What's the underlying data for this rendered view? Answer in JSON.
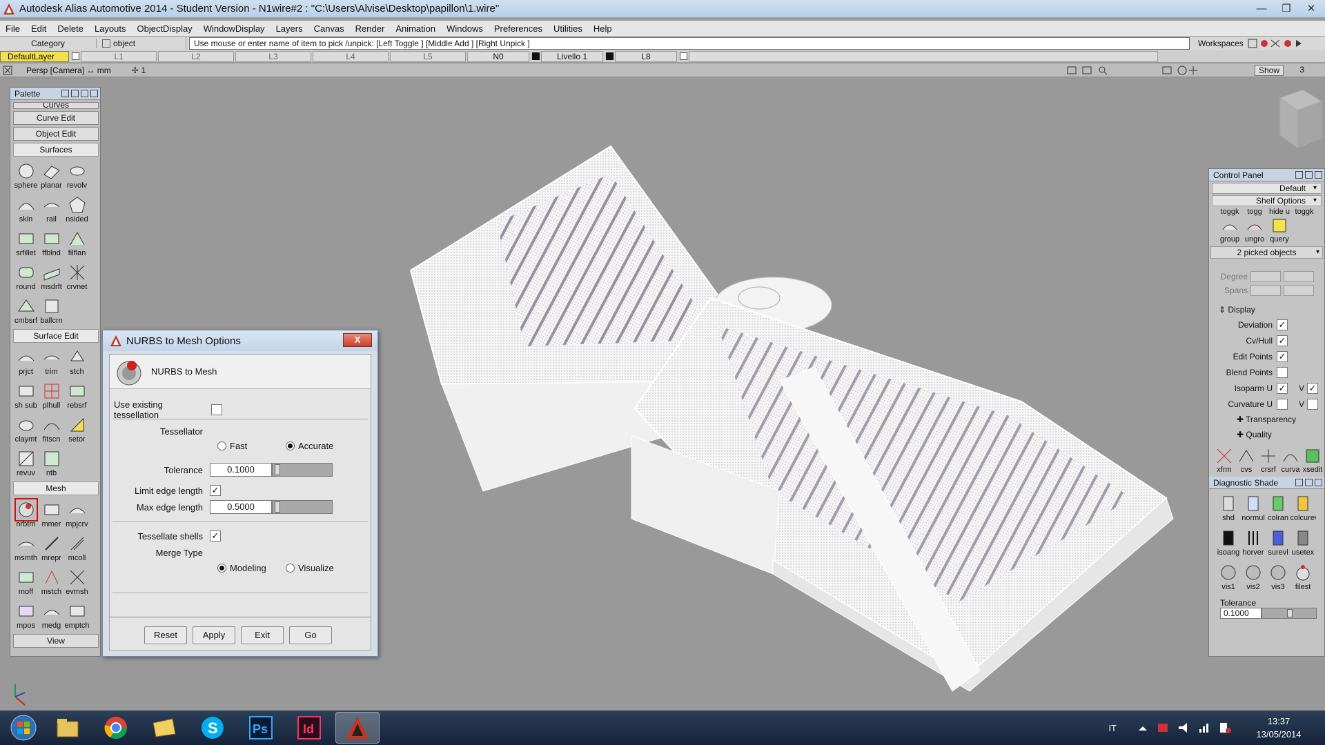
{
  "window": {
    "title": "Autodesk Alias Automotive 2014   - Student Version   - N1wire#2 : \"C:\\Users\\Alvise\\Desktop\\papillon\\1.wire\"",
    "controls": [
      "—",
      "❐",
      "✕"
    ]
  },
  "menu": [
    "File",
    "Edit",
    "Delete",
    "Layouts",
    "ObjectDisplay",
    "WindowDisplay",
    "Layers",
    "Canvas",
    "Render",
    "Animation",
    "Windows",
    "Preferences",
    "Utilities",
    "Help"
  ],
  "prompt": {
    "category": "Category",
    "object": "object",
    "text": "Use mouse or enter name of item to pick /unpick: [Left Toggle ] [Middle Add ] [Right Unpick ]",
    "workspaces": "Workspaces"
  },
  "layers": {
    "default": "DefaultLayer",
    "slots": [
      "L1",
      "L2",
      "L3",
      "L4",
      "L5"
    ],
    "n0": "N0",
    "livello": "Livello 1",
    "l8": "L8"
  },
  "viewbar": {
    "camera": "Persp [Camera] ↔ mm",
    "count": "1",
    "show": "Show",
    "num": "3"
  },
  "palette": {
    "title": "Palette",
    "curves": "Curves",
    "curve_edit": "Curve Edit",
    "object_edit": "Object Edit",
    "surfaces": "Surfaces",
    "surfaces_tools": [
      "sphere",
      "planar",
      "revolv",
      "skin",
      "rail",
      "nsided",
      "srfillet",
      "ffblnd",
      "filflan",
      "round",
      "msdrft",
      "crvnet",
      "cmbsrf",
      "ballcrn"
    ],
    "surface_edit": "Surface Edit",
    "surface_edit_tools": [
      "prjct",
      "trim",
      "stch",
      "sh sub",
      "plhull",
      "rebsrf",
      "claymt",
      "fitscn",
      "setor",
      "revuv",
      "ntb"
    ],
    "mesh": "Mesh",
    "mesh_tools": [
      "nrbtm",
      "mmer",
      "mpjcrv",
      "msmth",
      "mrepr",
      "mcoll",
      "moff",
      "mstch",
      "evmsh",
      "mpos",
      "medg",
      "emptch"
    ],
    "view": "View"
  },
  "dialog": {
    "title": "NURBS to Mesh Options",
    "header": "NURBS to Mesh",
    "use_existing_label": "Use existing tessellation",
    "use_existing_checked": false,
    "tessellator_label": "Tessellator",
    "fast_label": "Fast",
    "accurate_label": "Accurate",
    "tessellator_value": "Accurate",
    "tolerance_label": "Tolerance",
    "tolerance_value": "0.1000",
    "limit_edge_label": "Limit edge length",
    "limit_edge_checked": true,
    "max_edge_label": "Max edge length",
    "max_edge_value": "0.5000",
    "shells_label": "Tessellate shells",
    "shells_checked": true,
    "merge_label": "Merge Type",
    "modeling_label": "Modeling",
    "visualize_label": "Visualize",
    "merge_value": "Modeling",
    "buttons": {
      "reset": "Reset",
      "apply": "Apply",
      "exit": "Exit",
      "go": "Go"
    },
    "close": "X"
  },
  "control_panel": {
    "title": "Control Panel",
    "preset": "Default",
    "shelf_options": "Shelf Options",
    "shelf_row1": [
      "toggk",
      "togg",
      "hide u",
      "toggk"
    ],
    "shelf_row2": [
      "group",
      "ungro",
      "query"
    ],
    "picked": "2 picked objects",
    "degree": "Degree",
    "spans": "Spans",
    "display_header": "Display",
    "display_rows": [
      {
        "label": "Deviation",
        "checked": true
      },
      {
        "label": "Cv/Hull",
        "checked": true
      },
      {
        "label": "Edit Points",
        "checked": true
      },
      {
        "label": "Blend Points",
        "checked": false
      },
      {
        "label": "Isoparm U",
        "checked": true,
        "v_checked": true
      },
      {
        "label": "Curvature U",
        "checked": false,
        "v_checked": false
      }
    ],
    "v_label": "V",
    "transparency": "Transparency",
    "quality": "Quality",
    "eval_tools": [
      "xfrm",
      "cvs",
      "crsrf",
      "curva",
      "xsedit"
    ],
    "diagnostic_title": "Diagnostic Shade",
    "diag_tools": [
      "shd",
      "normul",
      "colran",
      "colcurevl",
      "isoang",
      "horver",
      "surevl",
      "usetex",
      "vis1",
      "vis2",
      "vis3",
      "filest"
    ],
    "tolerance_label": "Tolerance",
    "tolerance_value": "0.1000"
  },
  "taskbar": {
    "apps": [
      "explorer",
      "chrome",
      "folder",
      "skype",
      "Ps",
      "Id",
      "alias"
    ],
    "lang": "IT",
    "time": "13:37",
    "date": "13/05/2014"
  },
  "colors": {
    "viewport_bg": "#999999",
    "mesh": "#ffffff",
    "layer_default": "#f4e14a",
    "close_red": "#c8402c"
  }
}
